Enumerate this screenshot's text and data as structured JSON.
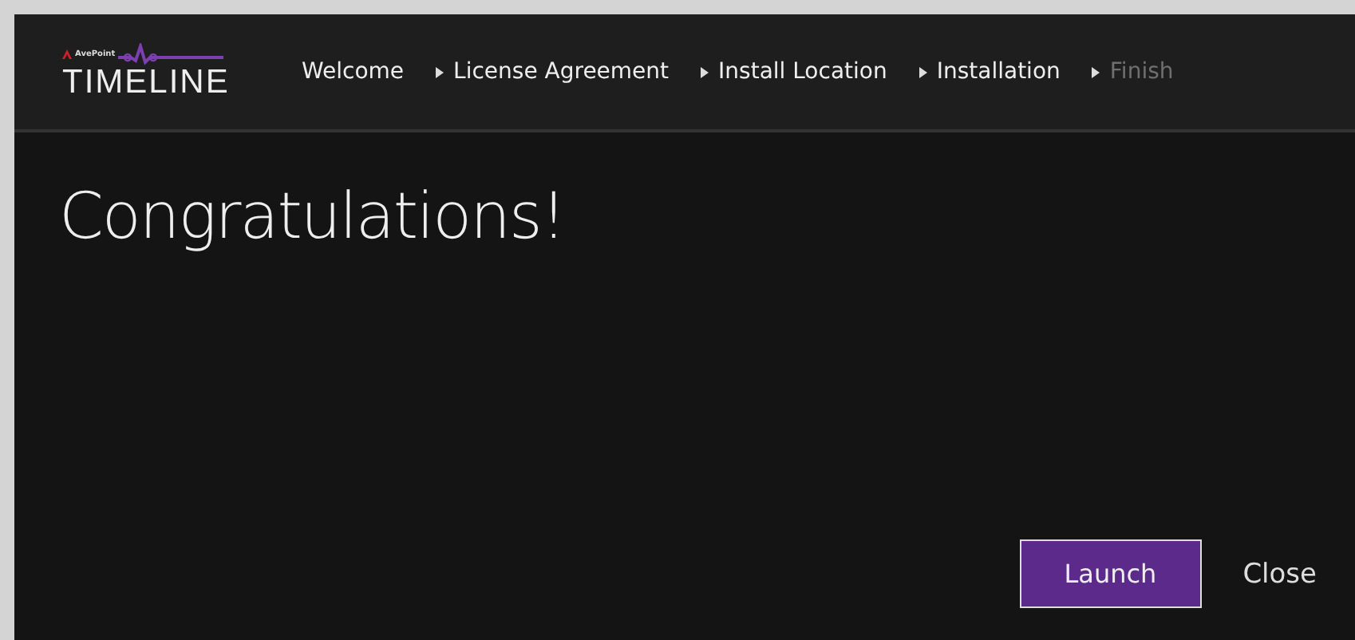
{
  "logo": {
    "brand": "AvePoint",
    "product": "TIMELINE"
  },
  "steps": [
    {
      "label": "Welcome",
      "done": true,
      "arrow": false
    },
    {
      "label": "License Agreement",
      "done": true,
      "arrow": true
    },
    {
      "label": "Install Location",
      "done": true,
      "arrow": true
    },
    {
      "label": "Installation",
      "done": true,
      "arrow": true
    },
    {
      "label": "Finish",
      "done": false,
      "arrow": true
    }
  ],
  "heading": "Congratulations!",
  "buttons": [
    {
      "label": "Launch",
      "kind": "primary"
    },
    {
      "label": "Close",
      "kind": "plain"
    }
  ]
}
